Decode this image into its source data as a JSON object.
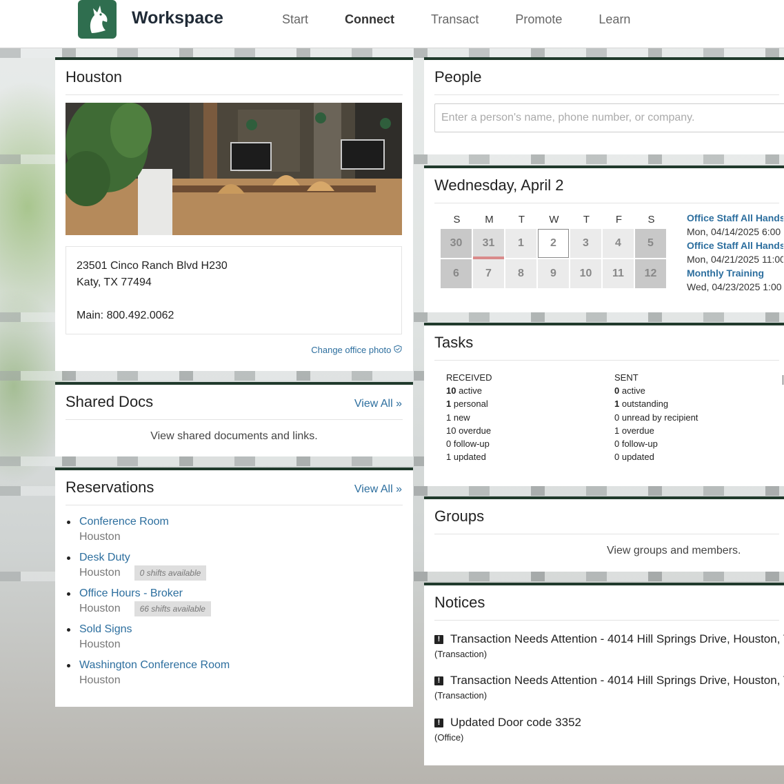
{
  "header": {
    "brand": "Workspace",
    "nav": [
      "Start",
      "Connect",
      "Transact",
      "Promote",
      "Learn"
    ],
    "active_nav": "Connect"
  },
  "office": {
    "title": "Houston",
    "address_line1": "23501 Cinco Ranch Blvd H230",
    "address_line2": "Katy, TX 77494",
    "phone": "Main: 800.492.0062",
    "change_photo": "Change office photo"
  },
  "shared_docs": {
    "title": "Shared Docs",
    "view_all": "View All",
    "description": "View shared documents and links."
  },
  "reservations": {
    "title": "Reservations",
    "view_all": "View All",
    "items": [
      {
        "name": "Conference Room",
        "location": "Houston",
        "badge": ""
      },
      {
        "name": "Desk Duty",
        "location": "Houston",
        "badge": "0 shifts available"
      },
      {
        "name": "Office Hours - Broker",
        "location": "Houston",
        "badge": "66 shifts available"
      },
      {
        "name": "Sold Signs",
        "location": "Houston",
        "badge": ""
      },
      {
        "name": "Washington Conference Room",
        "location": "Houston",
        "badge": ""
      }
    ]
  },
  "people": {
    "title": "People",
    "placeholder": "Enter a person's name, phone number, or company."
  },
  "calendar": {
    "title": "Wednesday, April 2",
    "weekdays": [
      "S",
      "M",
      "T",
      "W",
      "T",
      "F",
      "S"
    ],
    "week1": [
      "30",
      "31",
      "1",
      "2",
      "3",
      "4",
      "5"
    ],
    "week2": [
      "6",
      "7",
      "8",
      "9",
      "10",
      "11",
      "12"
    ],
    "events": [
      {
        "title": "Office Staff All Hands",
        "time": "Mon, 04/14/2025 6:00"
      },
      {
        "title": "Office Staff All Hands",
        "time": "Mon, 04/21/2025 11:00"
      },
      {
        "title": "Monthly Training",
        "time": "Wed, 04/23/2025 1:00"
      }
    ]
  },
  "tasks": {
    "title": "Tasks",
    "received": {
      "heading": "RECEIVED",
      "active_n": "10",
      "active_l": " active",
      "personal_n": "1",
      "personal_l": " personal",
      "new": "1 new",
      "overdue": "10 overdue",
      "followup": "0 follow-up",
      "updated": "1 updated"
    },
    "sent": {
      "heading": "SENT",
      "active_n": "0",
      "active_l": " active",
      "outstanding_n": "1",
      "outstanding_l": " outstanding",
      "unread": "0 unread by recipient",
      "overdue": "1 overdue",
      "followup": "0 follow-up",
      "updated": "0 updated"
    }
  },
  "groups": {
    "title": "Groups",
    "description": "View groups and members."
  },
  "notices": {
    "title": "Notices",
    "items": [
      {
        "title": "Transaction Needs Attention - 4014 Hill Springs Drive, Houston, T",
        "category": "(Transaction)"
      },
      {
        "title": "Transaction Needs Attention - 4014 Hill Springs Drive, Houston, T",
        "category": "(Transaction)"
      },
      {
        "title": "Updated Door code 3352",
        "category": "(Office)"
      }
    ]
  }
}
